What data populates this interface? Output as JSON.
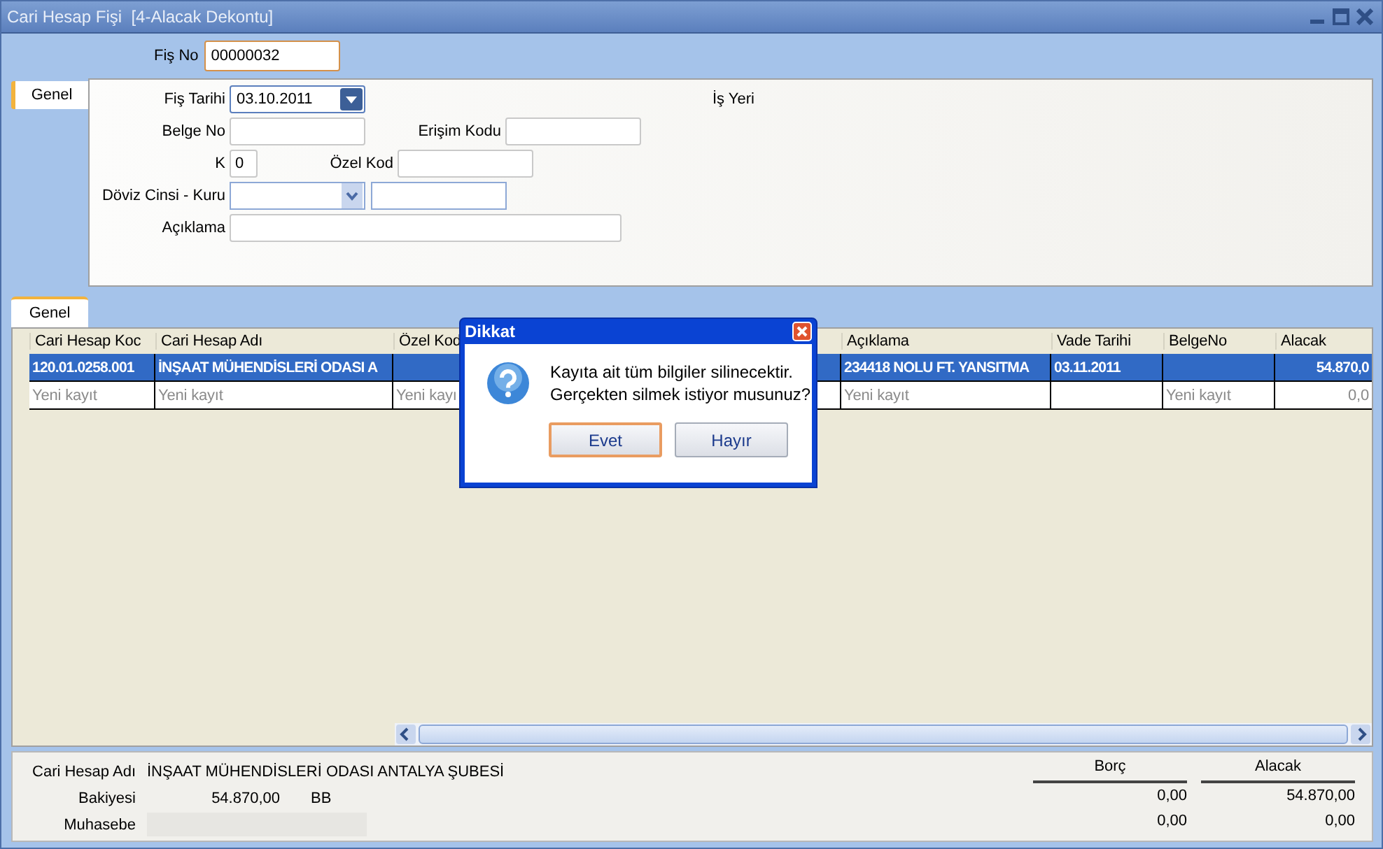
{
  "window": {
    "title": "Cari Hesap Fişi  [4-Alacak Dekontu]"
  },
  "header": {
    "label": "Fiş No",
    "value": "00000032"
  },
  "form": {
    "tab": {
      "label": "Genel",
      "selected": true
    },
    "rows": [
      {
        "left": {
          "label": "Fiş Tarihi",
          "kind": "date",
          "value": "03.10.2011"
        },
        "right": {
          "label": "İş Yeri",
          "kind": "caption"
        }
      },
      {
        "left": {
          "label": "Belge No",
          "kind": "text"
        },
        "right": {
          "label": "Erişim Kodu",
          "kind": "text"
        }
      },
      {
        "left": {
          "label": "K",
          "kind": "short",
          "value": "0"
        },
        "right": {
          "label": "Özel Kod",
          "kind": "text"
        }
      },
      {
        "left": {
          "label": "Döviz Cinsi - Kuru",
          "kind": "combo_rate"
        }
      },
      {
        "left": {
          "label": "Açıklama",
          "kind": "wide"
        }
      }
    ]
  },
  "grid_tab": {
    "label": "Genel",
    "selected": true
  },
  "grid": {
    "columns": [
      "Cari Hesap Koc",
      "Cari Hesap Adı",
      "Özel Kod",
      "Açıklama",
      "Vade Tarihi",
      "BelgeNo",
      "Alacak"
    ],
    "rows": [
      {
        "selected": true,
        "new": false,
        "cells": [
          "120.01.0258.001",
          "İNŞAAT MÜHENDİSLERİ ODASI A",
          null,
          "234418 NOLU FT. YANSITMA",
          "03.11.2011",
          null,
          "54.870,0"
        ]
      },
      {
        "selected": false,
        "new": true,
        "cells": [
          "Yeni kayıt",
          "Yeni kayıt",
          "Yeni kayı",
          "Yeni kayıt",
          null,
          "Yeni kayıt",
          "0,0"
        ]
      }
    ]
  },
  "dialog": {
    "title": "Dikkat",
    "message": [
      "Kayıta ait tüm bilgiler silinecektir.",
      "Gerçekten silmek istiyor musunuz?"
    ],
    "buttons": [
      {
        "label": "Evet",
        "default": true
      },
      {
        "label": "Hayır",
        "default": false
      }
    ]
  },
  "summary": {
    "account": {
      "label": "Cari Hesap Adı",
      "value": "İNŞAAT MÜHENDİSLERİ ODASI ANTALYA ŞUBESİ"
    },
    "balance": {
      "label": "Bakiyesi",
      "value": "54.870,00",
      "type": "BB"
    },
    "accounting": {
      "label": "Muhasebe"
    },
    "debit": {
      "label": "Borç",
      "values": [
        "0,00",
        "0,00"
      ]
    },
    "credit": {
      "label": "Alacak",
      "values": [
        "54.870,00",
        "0,00"
      ]
    }
  }
}
